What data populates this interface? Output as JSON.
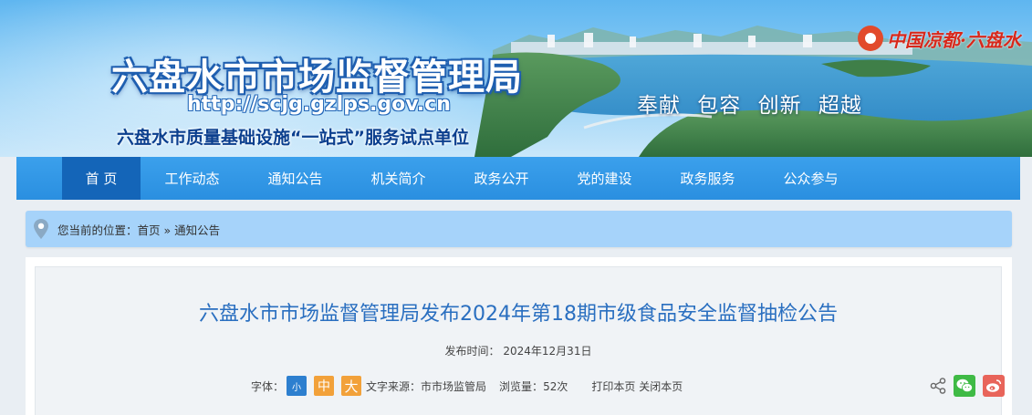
{
  "header": {
    "title": "六盘水市市场监督管理局",
    "url": "http://scjg.gzlps.gov.cn",
    "tagline": "六盘水市质量基础设施“一站式”服务试点单位",
    "slogan": "奉献 包容 创新 超越",
    "logo_text": "中国凉都·六盘水"
  },
  "nav": {
    "items": [
      {
        "label": "首 页",
        "active": true
      },
      {
        "label": "工作动态"
      },
      {
        "label": "通知公告"
      },
      {
        "label": "机关简介"
      },
      {
        "label": "政务公开"
      },
      {
        "label": "党的建设"
      },
      {
        "label": "政务服务"
      },
      {
        "label": "公众参与"
      }
    ]
  },
  "breadcrumb": {
    "prefix": "您当前的位置：",
    "home": "首页",
    "separator": " » ",
    "current": "通知公告"
  },
  "article": {
    "title": "六盘水市市场监督管理局发布2024年第18期市级食品安全监督抽检公告",
    "publish_label": "发布时间：",
    "publish_date": "2024年12月31日",
    "font_label": "字体：",
    "font_small": "小",
    "font_medium": "中",
    "font_large": "大",
    "source_label": "文字来源：",
    "source": "市市场监管局",
    "views_label": "浏览量：",
    "views": "52次",
    "print_label": "打印本页",
    "close_label": "关闭本页"
  },
  "share": {
    "icons": [
      "share-icon",
      "wechat-icon",
      "weibo-icon"
    ]
  },
  "colors": {
    "nav_bg": "#2a8fe0",
    "nav_active": "#1465b8",
    "crumb_bg": "#a6d3fa",
    "title_color": "#2a6fc0",
    "font_small_bg": "#2d7fcf",
    "font_orange_bg": "#f2a13a",
    "wechat": "#3fba45",
    "weibo": "#e8645a"
  }
}
